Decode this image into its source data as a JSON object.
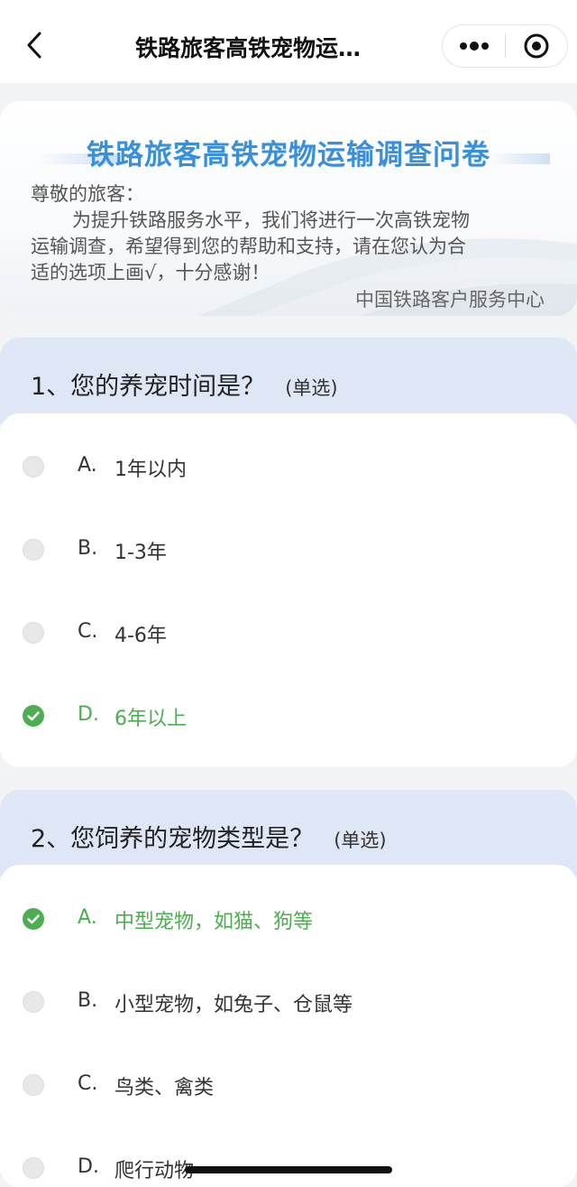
{
  "nav": {
    "title": "铁路旅客高铁宠物运…",
    "back_icon": "chevron-left-icon",
    "more_icon": "more-dots-icon",
    "close_icon": "target-close-icon"
  },
  "intro": {
    "title": "铁路旅客高铁宠物运输调查问卷",
    "greeting": "尊敬的旅客：",
    "line1": "为提升铁路服务水平，我们将进行一次高铁宠物",
    "line2": "运输调查，希望得到您的帮助和支持，请在您认为合",
    "line3": "适的选项上画√，十分感谢！",
    "signature": "中国铁路客户服务中心"
  },
  "questions": [
    {
      "title": "1、您的养宠时间是？",
      "tag": "(单选)",
      "options": [
        {
          "letter": "A.",
          "text": "1年以内",
          "selected": false
        },
        {
          "letter": "B.",
          "text": "1-3年",
          "selected": false
        },
        {
          "letter": "C.",
          "text": "4-6年",
          "selected": false
        },
        {
          "letter": "D.",
          "text": "6年以上",
          "selected": true
        }
      ]
    },
    {
      "title": "2、您饲养的宠物类型是？",
      "tag": "(单选)",
      "options": [
        {
          "letter": "A.",
          "text": "中型宠物，如猫、狗等",
          "selected": true
        },
        {
          "letter": "B.",
          "text": "小型宠物，如兔子、仓鼠等",
          "selected": false
        },
        {
          "letter": "C.",
          "text": "鸟类、禽类",
          "selected": false
        },
        {
          "letter": "D.",
          "text": "爬行动物",
          "selected": false
        }
      ]
    }
  ],
  "colors": {
    "accent_green": "#4cae50",
    "title_blue": "#3a8fdb",
    "question_header_bg": "#dfe6f6"
  }
}
